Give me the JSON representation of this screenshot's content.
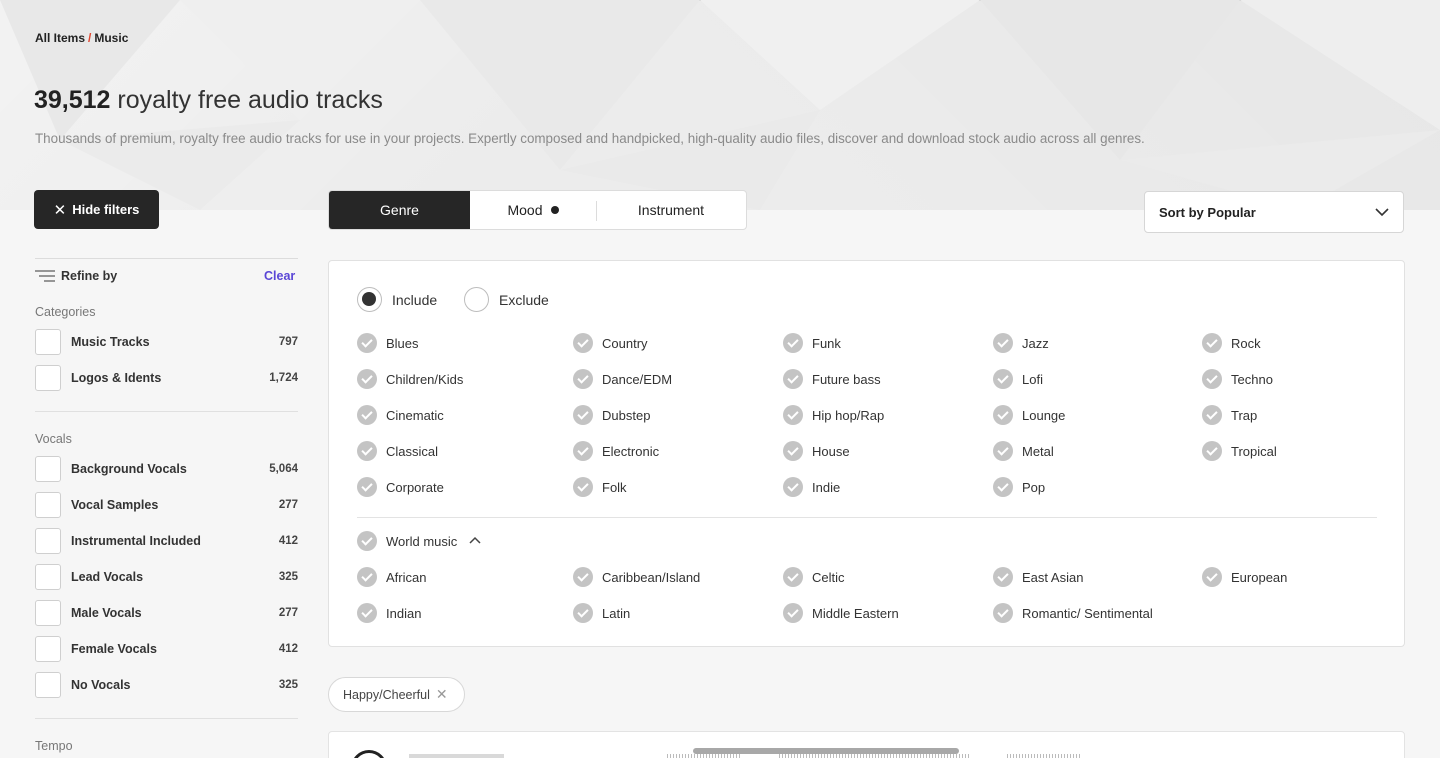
{
  "breadcrumb": {
    "root": "All Items",
    "separator": "/",
    "current": "Music"
  },
  "header": {
    "count": "39,512",
    "title_rest": "royalty free audio tracks",
    "subtitle": "Thousands of premium, royalty free audio tracks for use in your projects. Expertly composed and handpicked, high-quality audio files, discover and download stock audio across all genres."
  },
  "hide_filters": {
    "icon": "close-icon",
    "label": "Hide filters"
  },
  "tabs": [
    {
      "label": "Genre",
      "active": true
    },
    {
      "label": "Mood",
      "has_indicator": true
    },
    {
      "label": "Instrument"
    }
  ],
  "sort": {
    "label": "Sort by Popular",
    "icon": "chevron-down-icon"
  },
  "sidebar": {
    "refine_label": "Refine by",
    "clear_label": "Clear",
    "categories_label": "Categories",
    "categories": [
      {
        "label": "Music Tracks",
        "count": "797"
      },
      {
        "label": "Logos & Idents",
        "count": "1,724"
      }
    ],
    "vocals_label": "Vocals",
    "vocals": [
      {
        "label": "Background Vocals",
        "count": "5,064"
      },
      {
        "label": "Vocal Samples",
        "count": "277"
      },
      {
        "label": "Instrumental Included",
        "count": "412"
      },
      {
        "label": "Lead Vocals",
        "count": "325"
      },
      {
        "label": "Male Vocals",
        "count": "277"
      },
      {
        "label": "Female Vocals",
        "count": "412"
      },
      {
        "label": "No Vocals",
        "count": "325"
      }
    ],
    "tempo_label": "Tempo"
  },
  "genre_panel": {
    "include_label": "Include",
    "exclude_label": "Exclude",
    "mode": "include",
    "columns": [
      [
        "Blues",
        "Children/Kids",
        "Cinematic",
        "Classical",
        "Corporate"
      ],
      [
        "Country",
        "Dance/EDM",
        "Dubstep",
        "Electronic",
        "Folk"
      ],
      [
        "Funk",
        "Future bass",
        "Hip hop/Rap",
        "House",
        "Indie"
      ],
      [
        "Jazz",
        "Lofi",
        "Lounge",
        "Metal",
        "Pop"
      ],
      [
        "Rock",
        "Techno",
        "Trap",
        "Tropical"
      ]
    ],
    "world_label": "World music",
    "world_columns": [
      [
        "African",
        "Indian"
      ],
      [
        "Caribbean/Island",
        "Latin"
      ],
      [
        "Celtic",
        "Middle Eastern"
      ],
      [
        "East Asian",
        "Romantic/ Sentimental"
      ],
      [
        "European"
      ]
    ]
  },
  "active_chip": {
    "label": "Happy/Cheerful",
    "icon": "close-icon"
  }
}
